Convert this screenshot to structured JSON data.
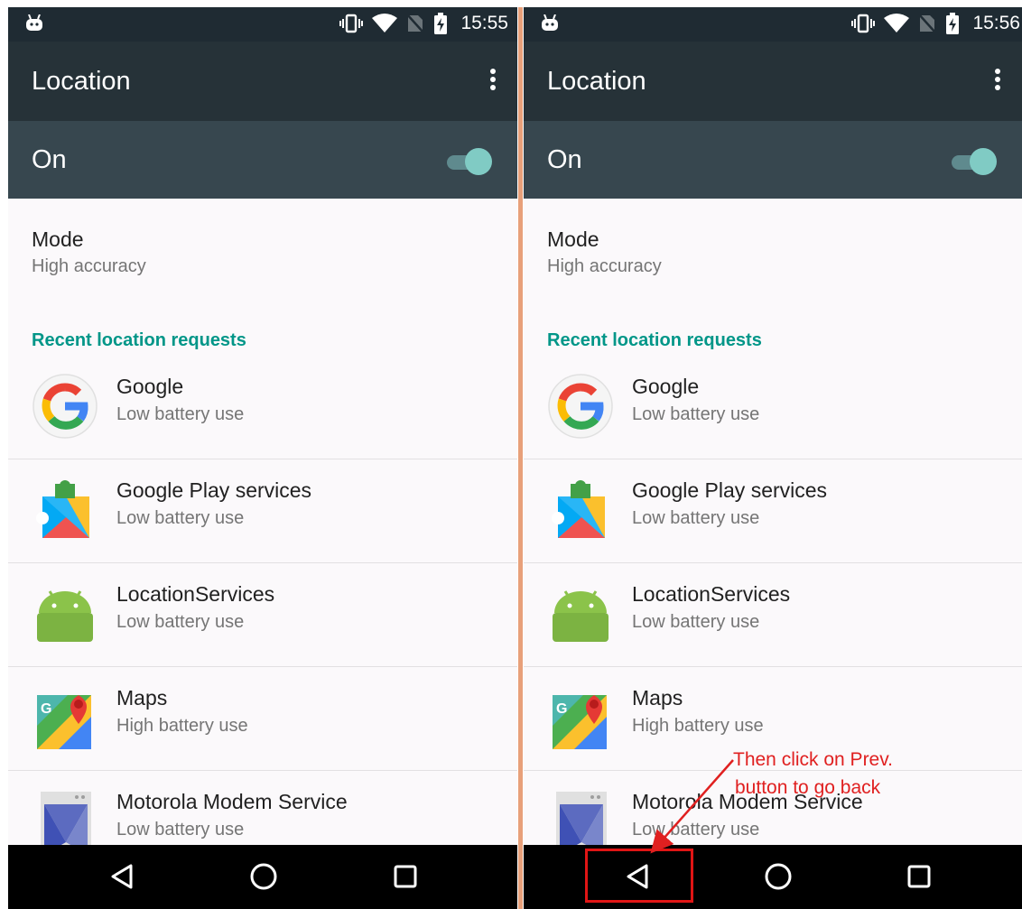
{
  "screens": [
    {
      "time": "15:55",
      "title": "Location",
      "toggle_label": "On",
      "mode_title": "Mode",
      "mode_value": "High accuracy",
      "section_title": "Recent location requests",
      "apps": [
        {
          "name": "Google",
          "usage": "Low battery use",
          "icon": "google-icon"
        },
        {
          "name": "Google Play services",
          "usage": "Low battery use",
          "icon": "play-services-icon"
        },
        {
          "name": "LocationServices",
          "usage": "Low battery use",
          "icon": "android-icon"
        },
        {
          "name": "Maps",
          "usage": "High battery use",
          "icon": "maps-icon"
        },
        {
          "name": "Motorola Modem Service",
          "usage": "Low battery use",
          "icon": "modem-service-icon"
        }
      ]
    },
    {
      "time": "15:56",
      "title": "Location",
      "toggle_label": "On",
      "mode_title": "Mode",
      "mode_value": "High accuracy",
      "section_title": "Recent location requests",
      "apps": [
        {
          "name": "Google",
          "usage": "Low battery use",
          "icon": "google-icon"
        },
        {
          "name": "Google Play services",
          "usage": "Low battery use",
          "icon": "play-services-icon"
        },
        {
          "name": "LocationServices",
          "usage": "Low battery use",
          "icon": "android-icon"
        },
        {
          "name": "Maps",
          "usage": "High battery use",
          "icon": "maps-icon"
        },
        {
          "name": "Motorola Modem Service",
          "usage": "Low battery use",
          "icon": "modem-service-icon"
        }
      ]
    }
  ],
  "annotation": {
    "line1": "Then click on Prev.",
    "line2": "button to go back",
    "color": "#e02020"
  },
  "colors": {
    "status_bar": "#1f2b33",
    "app_bar": "#263238",
    "toggle_bar": "#37474f",
    "accent": "#009688",
    "nav_bar": "#000000"
  }
}
